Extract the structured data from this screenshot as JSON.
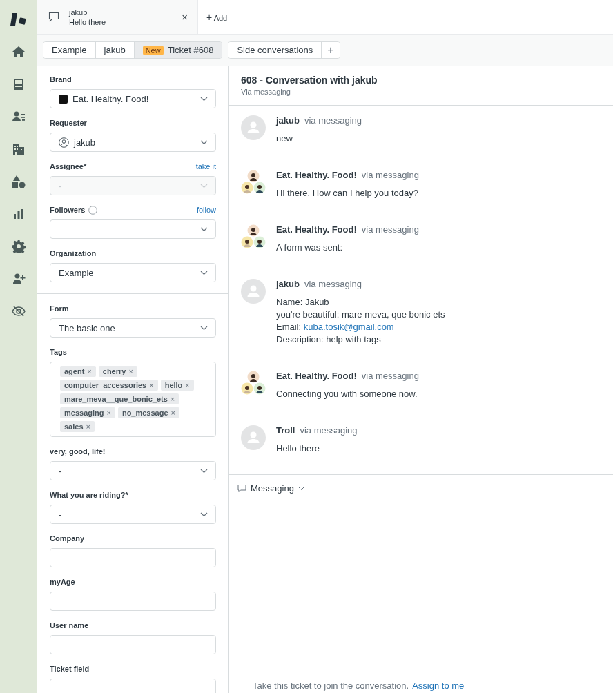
{
  "nav": [
    {
      "kind": "logo"
    },
    {
      "kind": "home"
    },
    {
      "kind": "inbox"
    },
    {
      "kind": "contacts"
    },
    {
      "kind": "building"
    },
    {
      "kind": "shapes"
    },
    {
      "kind": "chart"
    },
    {
      "kind": "gear"
    },
    {
      "kind": "add-user"
    },
    {
      "kind": "eye-slash"
    }
  ],
  "tab": {
    "title": "jakub",
    "subtitle": "Hello there",
    "close": "×"
  },
  "add_tab": {
    "icon": "+",
    "label": "Add"
  },
  "breadcrumbs": [
    {
      "label": "Example",
      "selected": false
    },
    {
      "label": "jakub",
      "selected": false
    },
    {
      "label": "Ticket #608",
      "badge": "New",
      "selected": true
    }
  ],
  "side_conversations": {
    "label": "Side conversations",
    "add": "+"
  },
  "properties": [
    [
      {
        "kind": "brand-select",
        "label": "Brand",
        "value": "Eat. Healthy. Food!",
        "disabled": false
      },
      {
        "kind": "person-select",
        "label": "Requester",
        "value": "jakub",
        "disabled": false
      },
      {
        "kind": "select",
        "label": "Assignee*",
        "value": "-",
        "action": "take it",
        "disabled": true
      },
      {
        "kind": "select",
        "label": "Followers",
        "info": true,
        "action": "follow",
        "disabled": false
      },
      {
        "kind": "select",
        "label": "Organization",
        "value": "Example",
        "disabled": false
      }
    ],
    [
      {
        "kind": "select",
        "label": "Form",
        "value": "The basic one",
        "disabled": false
      },
      {
        "kind": "tags",
        "label": "Tags",
        "tags": [
          "agent",
          "cherry",
          "computer_accessories",
          "hello",
          "mare_meva__que_bonic_ets",
          "messaging",
          "no_message",
          "sales"
        ],
        "remove": "×"
      },
      {
        "kind": "select",
        "label": "very, good, life!",
        "value": "-",
        "disabled": false
      },
      {
        "kind": "select",
        "label": "What you are riding?*",
        "value": "-",
        "disabled": false
      },
      {
        "kind": "input",
        "label": "Company"
      },
      {
        "kind": "input",
        "label": "myAge"
      },
      {
        "kind": "input",
        "label": "User name"
      },
      {
        "kind": "input",
        "label": "Ticket field"
      }
    ]
  ],
  "conversation": {
    "title": "608 - Conversation with jakub",
    "subtitle": "Via messaging"
  },
  "messages": [
    {
      "kind": "user",
      "author": "jakub",
      "via": "via messaging",
      "lines": [
        {
          "text": "new"
        }
      ]
    },
    {
      "kind": "brand",
      "author": "Eat. Healthy. Food!",
      "via": "via messaging",
      "lines": [
        {
          "text": "Hi there. How can I help you today?"
        }
      ]
    },
    {
      "kind": "brand",
      "author": "Eat. Healthy. Food!",
      "via": "via messaging",
      "lines": [
        {
          "text": "A form was sent:"
        }
      ]
    },
    {
      "kind": "user",
      "author": "jakub",
      "via": "via messaging",
      "lines": [
        {
          "text": "Name: Jakub"
        },
        {
          "text": "you're beautiful: mare meva, que bonic ets"
        },
        {
          "text": "Email: ",
          "link": "kuba.tosik@gmail.com"
        },
        {
          "text": "Description: help with tags"
        }
      ]
    },
    {
      "kind": "brand",
      "author": "Eat. Healthy. Food!",
      "via": "via messaging",
      "lines": [
        {
          "text": "Connecting you with someone now."
        }
      ]
    },
    {
      "kind": "user",
      "author": "Troll",
      "via": "via messaging",
      "lines": [
        {
          "text": "Hello there"
        }
      ]
    }
  ],
  "composer": {
    "channel": "Messaging"
  },
  "footer": {
    "text": "Take this ticket to join the conversation.",
    "link": "Assign to me"
  }
}
